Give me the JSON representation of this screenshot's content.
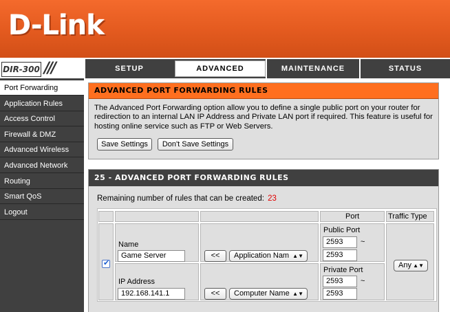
{
  "brand": {
    "logo_text": "D-Link",
    "model": "DIR-300"
  },
  "nav": {
    "tabs": [
      "SETUP",
      "ADVANCED",
      "MAINTENANCE",
      "STATUS"
    ],
    "active": "ADVANCED"
  },
  "sidebar": {
    "items": [
      "Port Forwarding",
      "Application Rules",
      "Access Control",
      "Firewall & DMZ",
      "Advanced Wireless",
      "Advanced Network",
      "Routing",
      "Smart QoS",
      "Logout"
    ],
    "active": "Port Forwarding"
  },
  "section1": {
    "title": "ADVANCED PORT FORWARDING RULES",
    "description": "The Advanced Port Forwarding option allow you to define a single public port on your router for redirection to an internal LAN IP Address and Private LAN port if required. This feature is useful for hosting online service such as FTP or Web Servers.",
    "save_label": "Save Settings",
    "dont_save_label": "Don't Save Settings"
  },
  "section2": {
    "title": "25 - ADVANCED PORT FORWARDING RULES",
    "remaining_label": "Remaining number of rules that can be created:",
    "remaining_count": "23",
    "headers": {
      "port": "Port",
      "traffic_type": "Traffic Type"
    },
    "rule": {
      "checked": true,
      "name_label": "Name",
      "name_value": "Game Server",
      "ip_label": "IP Address",
      "ip_value": "192.168.141.1",
      "arrow_button": "<<",
      "app_select": "Application Nam",
      "computer_select": "Computer Name",
      "public_port_label": "Public Port",
      "public_port_start": "2593",
      "public_port_end": "2593",
      "private_port_label": "Private Port",
      "private_port_start": "2593",
      "private_port_end": "2593",
      "range_sep": "~",
      "traffic_type_value": "Any"
    }
  },
  "colors": {
    "header_orange": "#e35a1f",
    "nav_dark": "#404040",
    "section_orange": "#ff6f1f",
    "panel_gray": "#dfdfdf",
    "count_red": "#e00000"
  }
}
